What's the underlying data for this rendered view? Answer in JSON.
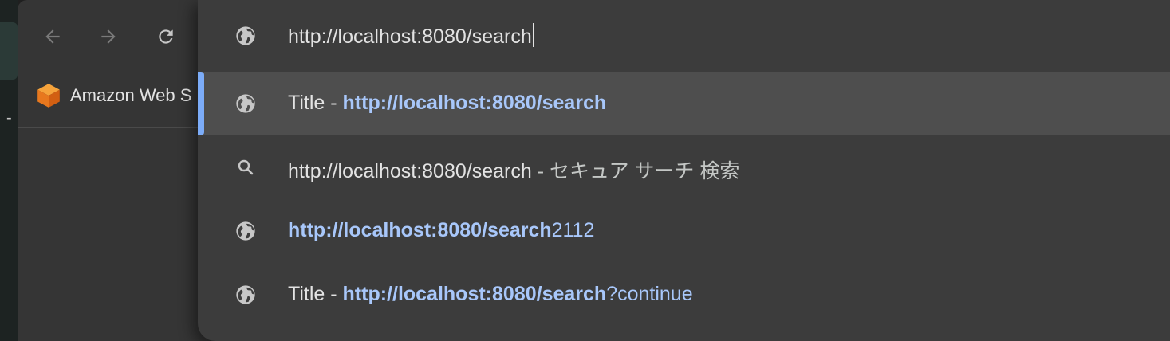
{
  "toolbar": {
    "back_icon": "arrow-left-icon",
    "forward_icon": "arrow-right-icon",
    "reload_icon": "reload-icon"
  },
  "bookmarks": [
    {
      "label": "Amazon Web S",
      "icon": "aws-cube-icon"
    }
  ],
  "omnibox": {
    "value": "http://localhost:8080/search",
    "icon": "globe-icon"
  },
  "suggestions": [
    {
      "icon": "globe-icon",
      "prefix": "Title - ",
      "match": "http://localhost:8080/search",
      "suffix": "",
      "selected": true
    },
    {
      "icon": "search-icon",
      "prefix": "",
      "match": "http://localhost:8080/search",
      "suffix": " - セキュア サーチ 検索",
      "selected": false
    },
    {
      "icon": "globe-icon",
      "prefix": "",
      "match": "http://localhost:8080/search",
      "suffix": "2112",
      "selected": false
    },
    {
      "icon": "globe-icon",
      "prefix": "Title - ",
      "match": "http://localhost:8080/search",
      "suffix": "?continue",
      "selected": false
    }
  ],
  "colors": {
    "accent": "#7cacf8",
    "url_blue": "#a8c7fa",
    "popup_bg": "#3c3c3c",
    "selected_bg": "#4e4e4e"
  }
}
